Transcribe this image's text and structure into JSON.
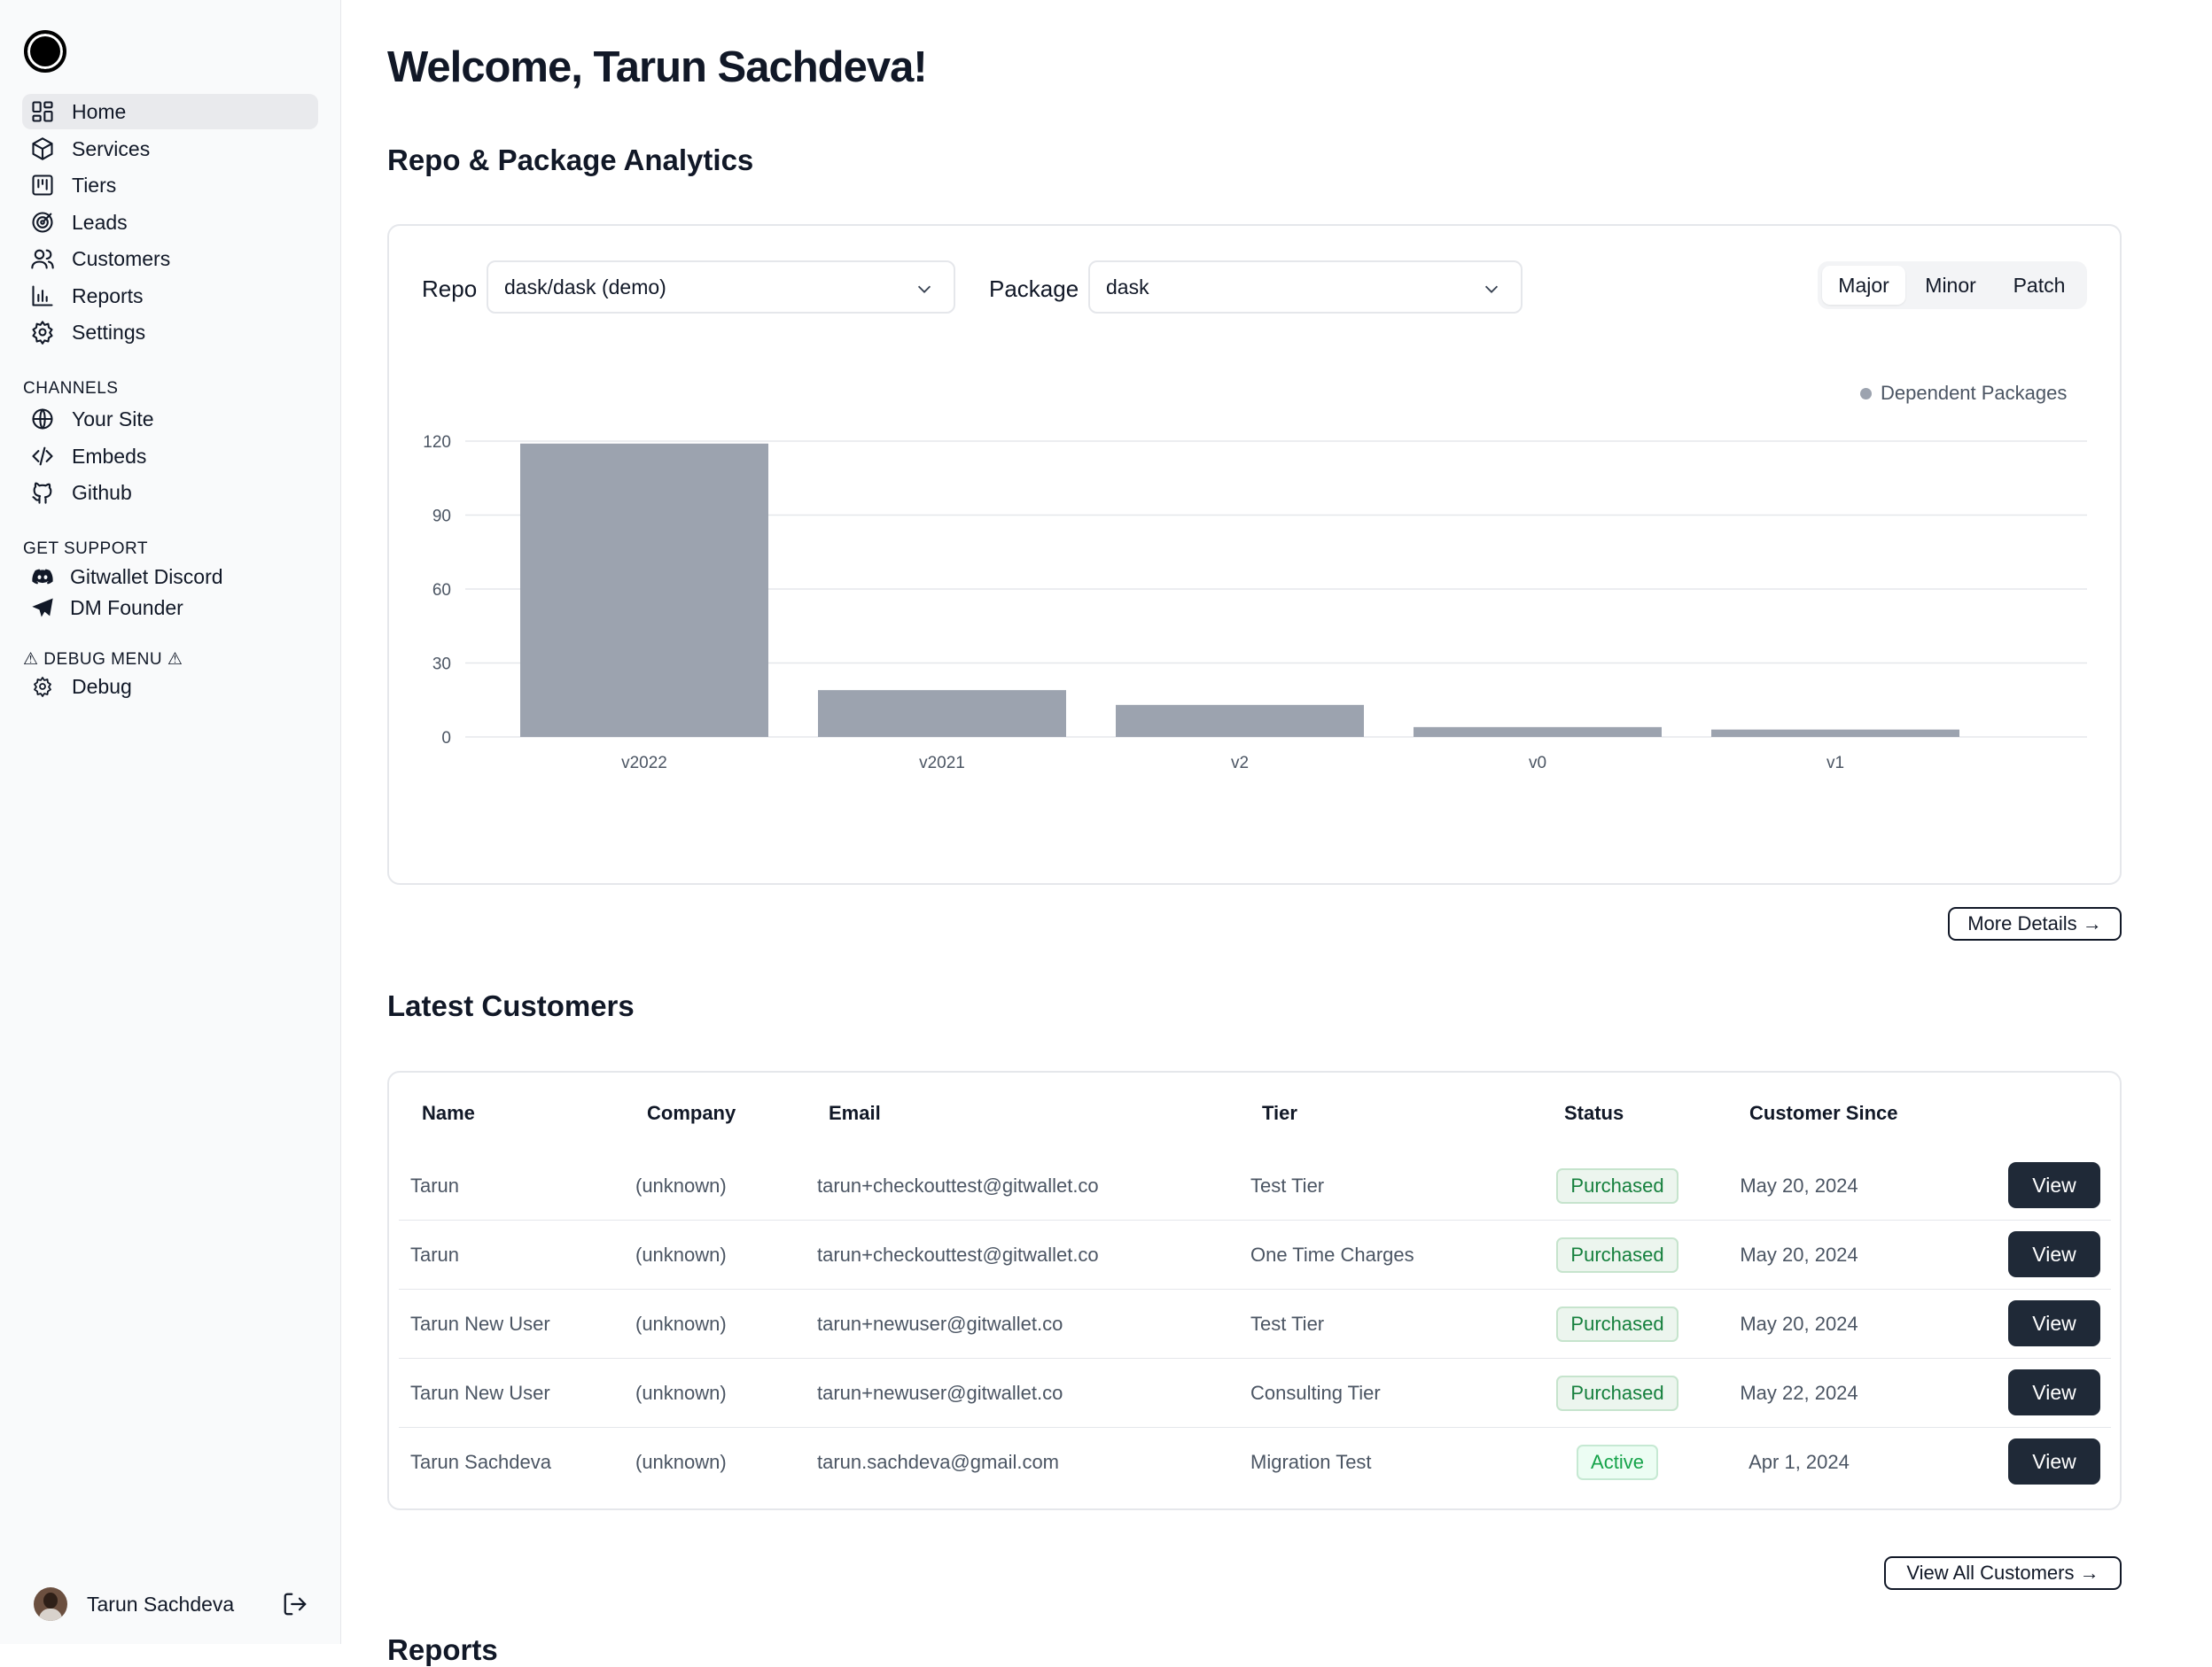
{
  "sidebar": {
    "nav": [
      {
        "label": "Home",
        "icon": "dashboard-grid-icon",
        "active": true
      },
      {
        "label": "Services",
        "icon": "package-box-icon"
      },
      {
        "label": "Tiers",
        "icon": "kanban-columns-icon"
      },
      {
        "label": "Leads",
        "icon": "target-icon"
      },
      {
        "label": "Customers",
        "icon": "users-icon"
      },
      {
        "label": "Reports",
        "icon": "bar-chart-icon"
      },
      {
        "label": "Settings",
        "icon": "gear-icon"
      }
    ],
    "channels_heading": "CHANNELS",
    "channels": [
      {
        "label": "Your Site",
        "icon": "globe-icon"
      },
      {
        "label": "Embeds",
        "icon": "code-icon"
      },
      {
        "label": "Github",
        "icon": "github-icon"
      }
    ],
    "support_heading": "GET SUPPORT",
    "support": [
      {
        "label": "Gitwallet Discord",
        "icon": "discord-icon"
      },
      {
        "label": "DM Founder",
        "icon": "send-icon"
      }
    ],
    "debug_heading": "⚠ DEBUG MENU ⚠",
    "debug": [
      {
        "label": "Debug",
        "icon": "gear-icon"
      }
    ],
    "user": {
      "name": "Tarun Sachdeva"
    }
  },
  "main": {
    "title": "Welcome, Tarun Sachdeva!",
    "analytics": {
      "heading": "Repo & Package Analytics",
      "repo_label": "Repo",
      "repo_value": "dask/dask (demo)",
      "package_label": "Package",
      "package_value": "dask",
      "version_tabs": [
        {
          "label": "Major",
          "active": true
        },
        {
          "label": "Minor"
        },
        {
          "label": "Patch"
        }
      ],
      "more_details": "More Details →"
    },
    "customers": {
      "heading": "Latest Customers",
      "columns": [
        "Name",
        "Company",
        "Email",
        "Tier",
        "Status",
        "Customer Since"
      ],
      "rows": [
        {
          "name": "Tarun",
          "company": "(unknown)",
          "email": "tarun+checkouttest@gitwallet.co",
          "tier": "Test Tier",
          "status": "Purchased",
          "since": "May 20, 2024",
          "action": "View"
        },
        {
          "name": "Tarun",
          "company": "(unknown)",
          "email": "tarun+checkouttest@gitwallet.co",
          "tier": "One Time Charges",
          "status": "Purchased",
          "since": "May 20, 2024",
          "action": "View"
        },
        {
          "name": "Tarun New User",
          "company": "(unknown)",
          "email": "tarun+newuser@gitwallet.co",
          "tier": "Test Tier",
          "status": "Purchased",
          "since": "May 20, 2024",
          "action": "View"
        },
        {
          "name": "Tarun New User",
          "company": "(unknown)",
          "email": "tarun+newuser@gitwallet.co",
          "tier": "Consulting Tier",
          "status": "Purchased",
          "since": "May 22, 2024",
          "action": "View"
        },
        {
          "name": "Tarun Sachdeva",
          "company": "(unknown)",
          "email": "tarun.sachdeva@gmail.com",
          "tier": "Migration Test",
          "status": "Active",
          "since": "Apr 1, 2024",
          "action": "View"
        }
      ],
      "view_all": "View All Customers →"
    },
    "reports_heading": "Reports"
  },
  "colors": {
    "bar": "#9ca3af",
    "grid": "#e5e7eb",
    "primary_button": "#1f2937",
    "status_green": "#15803d"
  },
  "chart_data": {
    "type": "bar",
    "categories": [
      "v2022",
      "v2021",
      "v2",
      "v0",
      "v1"
    ],
    "series": [
      {
        "name": "Dependent Packages",
        "values": [
          119,
          19,
          13,
          4,
          3
        ]
      }
    ],
    "yticks": [
      0,
      30,
      60,
      90,
      120
    ],
    "ylim": [
      0,
      120
    ],
    "legend": "top-right",
    "grid": true
  }
}
